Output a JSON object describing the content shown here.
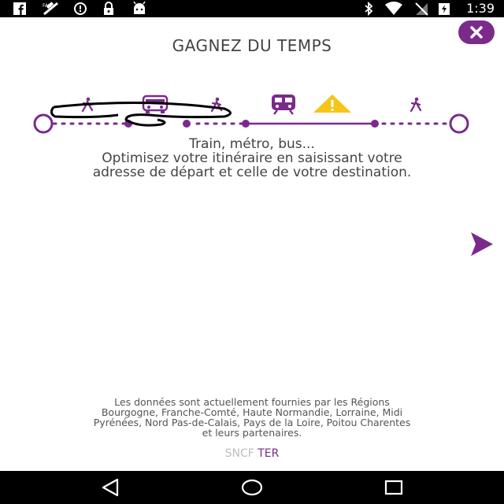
{
  "status_bar": {
    "time": "1:39",
    "icons": [
      "facebook-icon",
      "signal-disabled-icon",
      "alarm-icon",
      "lock-icon",
      "android-icon",
      "bluetooth-icon",
      "wifi-icon",
      "no-sim-icon",
      "battery-charging-icon"
    ]
  },
  "header": {
    "title": "GAGNEZ DU TEMPS"
  },
  "journey": {
    "icons": [
      "walk-icon",
      "bus-icon",
      "walk-icon",
      "train-icon",
      "warning-icon",
      "walk-icon"
    ],
    "accent_color": "#7b2a8c",
    "warning_color": "#f5c518"
  },
  "main": {
    "line1": "Train, métro, bus...",
    "line2": "Optimisez votre itinéraire en saisissant votre",
    "line3": "adresse de départ et celle de votre destination."
  },
  "footer": {
    "note_line1": "Les données sont actuellement fournies par les Régions",
    "note_line2": "Bourgogne, Franche-Comté, Haute Normandie, Lorraine, Midi",
    "note_line3": "Pyrénées, Nord Pas-de-Calais, Pays de la Loire, Poitou Charentes",
    "note_line4": "et leurs partenaires.",
    "brand_sncf": "SNCF",
    "brand_ter": "TER"
  },
  "nav_bar": {
    "buttons": [
      "back-icon",
      "home-icon",
      "recents-icon"
    ]
  }
}
